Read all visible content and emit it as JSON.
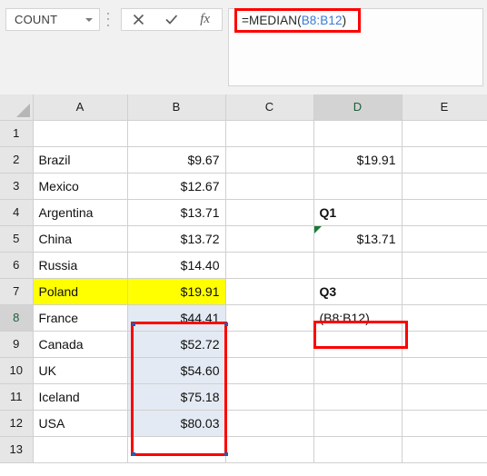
{
  "app": "Microsoft Excel",
  "formula_bar": {
    "name_box_value": "COUNT",
    "name_box_icon": "chevron-down-icon",
    "cancel_icon": "x-cancel-icon",
    "confirm_icon": "checkmark-confirm-icon",
    "insert_function_icon": "fx-insert-function-icon",
    "insert_function_label": "fx",
    "formula_prefix": "=MEDIAN(",
    "formula_reference": "B8:B12",
    "formula_suffix": ")",
    "formula_full": "=MEDIAN(B8:B12)",
    "reference_color": "#3a7bd5",
    "highlight_color": "#ff0000"
  },
  "grid": {
    "column_headers": [
      "A",
      "B",
      "C",
      "D",
      "E"
    ],
    "active_column": "D",
    "active_row": "8",
    "row_numbers": [
      "1",
      "2",
      "3",
      "4",
      "5",
      "6",
      "7",
      "8",
      "9",
      "10",
      "11",
      "12",
      "13"
    ],
    "rows": [
      {
        "num": "1",
        "a": "",
        "b": "",
        "c": "",
        "d": "",
        "e": ""
      },
      {
        "num": "2",
        "a": "Brazil",
        "b": "$9.67",
        "c": "",
        "d": "$19.91",
        "e": ""
      },
      {
        "num": "3",
        "a": "Mexico",
        "b": "$12.67",
        "c": "",
        "d": "",
        "e": ""
      },
      {
        "num": "4",
        "a": "Argentina",
        "b": "$13.71",
        "c": "",
        "d": "Q1",
        "e": ""
      },
      {
        "num": "5",
        "a": "China",
        "b": "$13.72",
        "c": "",
        "d": "$13.71",
        "e": ""
      },
      {
        "num": "6",
        "a": "Russia",
        "b": "$14.40",
        "c": "",
        "d": "",
        "e": ""
      },
      {
        "num": "7",
        "a": "Poland",
        "b": "$19.91",
        "c": "",
        "d": "Q3",
        "e": ""
      },
      {
        "num": "8",
        "a": "France",
        "b": "$44.41",
        "c": "",
        "d": "(B8:B12)",
        "e": ""
      },
      {
        "num": "9",
        "a": "Canada",
        "b": "$52.72",
        "c": "",
        "d": "",
        "e": ""
      },
      {
        "num": "10",
        "a": "UK",
        "b": "$54.60",
        "c": "",
        "d": "",
        "e": ""
      },
      {
        "num": "11",
        "a": "Iceland",
        "b": "$75.18",
        "c": "",
        "d": "",
        "e": ""
      },
      {
        "num": "12",
        "a": "USA",
        "b": "$80.03",
        "c": "",
        "d": "",
        "e": ""
      },
      {
        "num": "13",
        "a": "",
        "b": "",
        "c": "",
        "d": "",
        "e": ""
      }
    ]
  },
  "annotations": {
    "highlight_fill_color": "#ffff00",
    "selection_fill_color": "#e4eaf3",
    "annotation_box_color": "#ff0000",
    "active_border_color": "#1b7040",
    "error_indicator": "green-triangle-error-icon"
  }
}
